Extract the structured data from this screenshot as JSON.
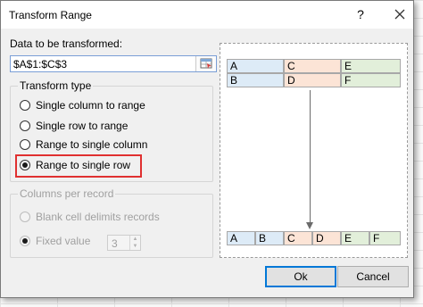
{
  "dialog": {
    "title": "Transform Range",
    "help_label": "?",
    "close_icon": "close-icon"
  },
  "range": {
    "label": "Data to be transformed:",
    "value": "$A$1:$C$3",
    "picker_icon": "range-select-icon"
  },
  "transform_type": {
    "title": "Transform type",
    "options": [
      {
        "label": "Single column to range",
        "checked": false
      },
      {
        "label": "Single row to range",
        "checked": false
      },
      {
        "label": "Range to single column",
        "checked": false
      },
      {
        "label": "Range to single row",
        "checked": true
      }
    ]
  },
  "columns_per_record": {
    "title": "Columns per record",
    "blank_cell_label": "Blank cell delimits records",
    "fixed_value_label": "Fixed value",
    "fixed_value": "3"
  },
  "preview": {
    "top_rows": [
      [
        "A",
        "C",
        "E"
      ],
      [
        "B",
        "D",
        "F"
      ]
    ],
    "bottom_row": [
      "A",
      "B",
      "C",
      "D",
      "E",
      "F"
    ],
    "colors": {
      "blue": "#ddebf7",
      "orange": "#fce4d6",
      "green": "#e2efda"
    }
  },
  "buttons": {
    "ok": "Ok",
    "cancel": "Cancel"
  },
  "highlight_color": "#e03030"
}
